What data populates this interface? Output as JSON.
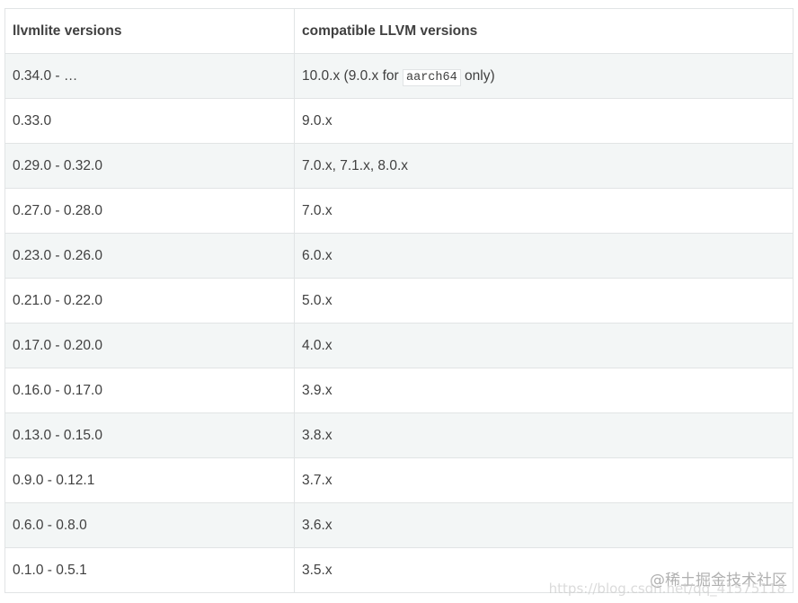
{
  "table": {
    "headers": [
      "llvmlite versions",
      "compatible LLVM versions"
    ],
    "rows": [
      {
        "llvmlite": "0.34.0 - …",
        "llvm_pre": "10.0.x (9.0.x for ",
        "llvm_code": "aarch64",
        "llvm_post": " only)"
      },
      {
        "llvmlite": "0.33.0",
        "llvm": "9.0.x"
      },
      {
        "llvmlite": "0.29.0 - 0.32.0",
        "llvm": "7.0.x, 7.1.x, 8.0.x"
      },
      {
        "llvmlite": "0.27.0 - 0.28.0",
        "llvm": "7.0.x"
      },
      {
        "llvmlite": "0.23.0 - 0.26.0",
        "llvm": "6.0.x"
      },
      {
        "llvmlite": "0.21.0 - 0.22.0",
        "llvm": "5.0.x"
      },
      {
        "llvmlite": "0.17.0 - 0.20.0",
        "llvm": "4.0.x"
      },
      {
        "llvmlite": "0.16.0 - 0.17.0",
        "llvm": "3.9.x"
      },
      {
        "llvmlite": "0.13.0 - 0.15.0",
        "llvm": "3.8.x"
      },
      {
        "llvmlite": "0.9.0 - 0.12.1",
        "llvm": "3.7.x"
      },
      {
        "llvmlite": "0.6.0 - 0.8.0",
        "llvm": "3.6.x"
      },
      {
        "llvmlite": "0.1.0 - 0.5.1",
        "llvm": "3.5.x"
      }
    ]
  },
  "watermark": {
    "cn": "@稀土掘金技术社区",
    "url": "https://blog.csdn.net/qq_41575118"
  },
  "colors": {
    "text": "#404040",
    "border": "#e1e4e5",
    "stripe": "#f3f6f6"
  }
}
